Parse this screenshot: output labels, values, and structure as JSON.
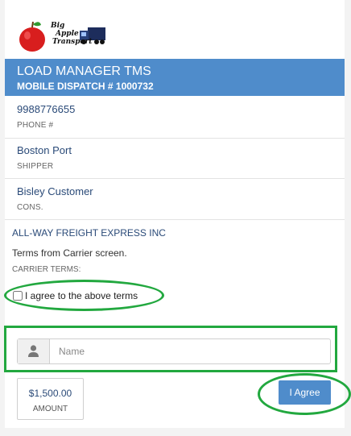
{
  "logo": {
    "line1": "Big",
    "line2": "Apple",
    "line3": "Transport"
  },
  "header": {
    "title": "LOAD MANAGER TMS",
    "subtitle": "MOBILE DISPATCH # 1000732"
  },
  "phone": {
    "value": "9988776655",
    "label": "PHONE #"
  },
  "shipper": {
    "value": "Boston Port",
    "label": "SHIPPER"
  },
  "consignee": {
    "value": "Bisley Customer",
    "label": "CONS."
  },
  "carrier": {
    "name": "ALL-WAY FREIGHT EXPRESS INC",
    "terms": "Terms from Carrier screen.",
    "terms_label": "CARRIER TERMS:"
  },
  "agree_checkbox": {
    "label": "I agree to the above terms",
    "checked": false
  },
  "name_field": {
    "placeholder": "Name",
    "value": ""
  },
  "amount": {
    "value": "$1,500.00",
    "label": "AMOUNT"
  },
  "agree_button": {
    "label": "I Agree"
  },
  "colors": {
    "header_bg": "#4f8ccb",
    "annotation_green": "#22a83f",
    "value_text": "#2a4a78"
  },
  "icons": {
    "logo": "apple-truck-logo",
    "name_addon": "user-icon"
  }
}
